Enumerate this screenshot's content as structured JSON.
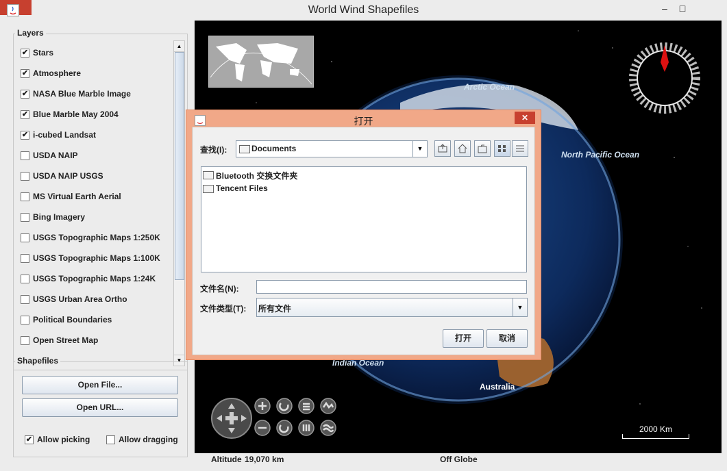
{
  "window": {
    "title": "World Wind Shapefiles",
    "minimize": "–",
    "maximize": "□",
    "close": "✕"
  },
  "layers": {
    "title": "Layers",
    "items": [
      {
        "label": "Stars",
        "checked": true
      },
      {
        "label": "Atmosphere",
        "checked": true
      },
      {
        "label": "NASA Blue Marble Image",
        "checked": true
      },
      {
        "label": "Blue Marble May 2004",
        "checked": true
      },
      {
        "label": "i-cubed Landsat",
        "checked": true
      },
      {
        "label": "USDA NAIP",
        "checked": false
      },
      {
        "label": "USDA NAIP USGS",
        "checked": false
      },
      {
        "label": "MS Virtual Earth Aerial",
        "checked": false
      },
      {
        "label": "Bing Imagery",
        "checked": false
      },
      {
        "label": "USGS Topographic Maps 1:250K",
        "checked": false
      },
      {
        "label": "USGS Topographic Maps 1:100K",
        "checked": false
      },
      {
        "label": "USGS Topographic Maps 1:24K",
        "checked": false
      },
      {
        "label": "USGS Urban Area Ortho",
        "checked": false
      },
      {
        "label": "Political Boundaries",
        "checked": false
      },
      {
        "label": "Open Street Map",
        "checked": false
      }
    ]
  },
  "shapefiles": {
    "title": "Shapefiles",
    "open_file": "Open File...",
    "open_url": "Open URL...",
    "allow_picking": "Allow picking",
    "allow_picking_checked": true,
    "allow_dragging": "Allow dragging",
    "allow_dragging_checked": false
  },
  "globe": {
    "labels": {
      "arctic": "Arctic Ocean",
      "north_pacific": "North Pacific Ocean",
      "indian": "Indian Ocean",
      "australia": "Australia"
    },
    "scale": "2000 Km"
  },
  "status": {
    "altitude_label": "Altitude",
    "altitude_value": "19,070 km",
    "position": "Off Globe"
  },
  "dialog": {
    "title": "打开",
    "close": "✕",
    "look_in_label": "查找(I):",
    "look_in_value": "Documents",
    "files": [
      {
        "name": "Bluetooth 交换文件夹"
      },
      {
        "name": "Tencent Files"
      }
    ],
    "filename_label": "文件名(N):",
    "filename_value": "",
    "filetype_label": "文件类型(T):",
    "filetype_value": "所有文件",
    "open_button": "打开",
    "cancel_button": "取消"
  }
}
